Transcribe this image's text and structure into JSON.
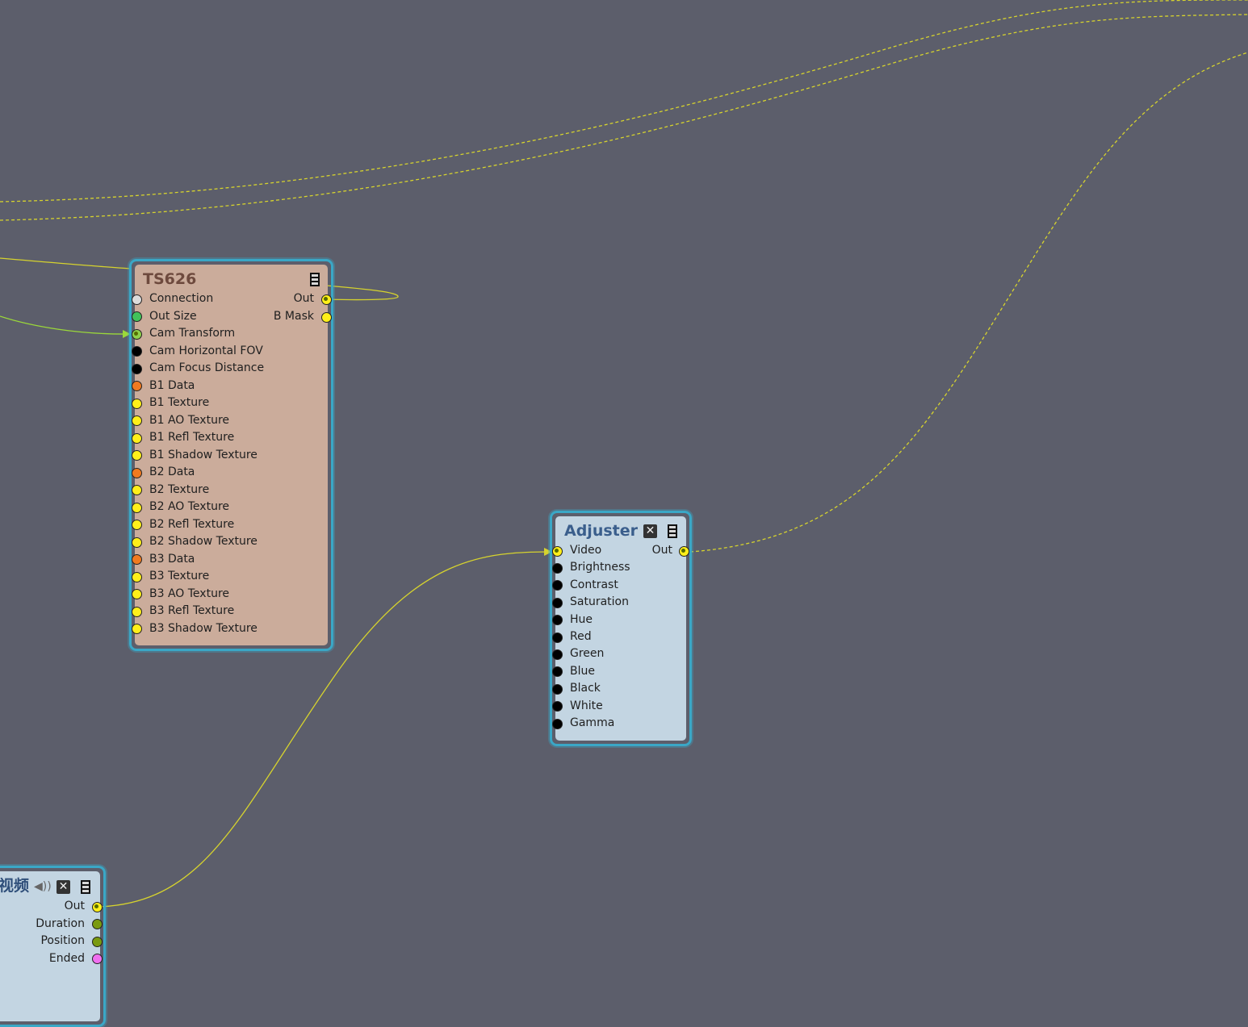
{
  "canvas": {
    "background": "#5c5e6b",
    "wire_color": "#d6d32e",
    "transform_wire_color": "#9bd83a"
  },
  "nodes": {
    "ts626": {
      "title": "TS626",
      "menu_icon": "menu-icon",
      "inputs": [
        {
          "label": "Connection",
          "color": "#dcdcdc"
        },
        {
          "label": "Out Size",
          "color": "#42c25a"
        },
        {
          "label": "Cam Transform",
          "color": "#8fd04a"
        },
        {
          "label": "Cam Horizontal FOV",
          "color": "#000000"
        },
        {
          "label": "Cam Focus Distance",
          "color": "#000000"
        },
        {
          "label": "B1 Data",
          "color": "#f07a20"
        },
        {
          "label": "B1 Texture",
          "color": "#ffef1a"
        },
        {
          "label": "B1 AO Texture",
          "color": "#ffef1a"
        },
        {
          "label": "B1 Refl Texture",
          "color": "#ffef1a"
        },
        {
          "label": "B1 Shadow Texture",
          "color": "#ffef1a"
        },
        {
          "label": "B2 Data",
          "color": "#f07a20"
        },
        {
          "label": "B2 Texture",
          "color": "#ffef1a"
        },
        {
          "label": "B2 AO Texture",
          "color": "#ffef1a"
        },
        {
          "label": "B2 Refl Texture",
          "color": "#ffef1a"
        },
        {
          "label": "B2 Shadow Texture",
          "color": "#ffef1a"
        },
        {
          "label": "B3 Data",
          "color": "#f07a20"
        },
        {
          "label": "B3 Texture",
          "color": "#ffef1a"
        },
        {
          "label": "B3 AO Texture",
          "color": "#ffef1a"
        },
        {
          "label": "B3 Refl Texture",
          "color": "#ffef1a"
        },
        {
          "label": "B3 Shadow Texture",
          "color": "#ffef1a"
        }
      ],
      "outputs": [
        {
          "label": "Out",
          "color": "#ffef1a"
        },
        {
          "label": "B Mask",
          "color": "#ffef1a"
        }
      ]
    },
    "adjuster": {
      "title": "Adjuster",
      "close_icon": "close-icon",
      "menu_icon": "menu-icon",
      "inputs": [
        {
          "label": "Video",
          "color": "#ffef1a"
        },
        {
          "label": "Brightness",
          "color": "#000000"
        },
        {
          "label": "Contrast",
          "color": "#000000"
        },
        {
          "label": "Saturation",
          "color": "#000000"
        },
        {
          "label": "Hue",
          "color": "#000000"
        },
        {
          "label": "Red",
          "color": "#000000"
        },
        {
          "label": "Green",
          "color": "#000000"
        },
        {
          "label": "Blue",
          "color": "#000000"
        },
        {
          "label": "Black",
          "color": "#000000"
        },
        {
          "label": "White",
          "color": "#000000"
        },
        {
          "label": "Gamma",
          "color": "#000000"
        }
      ],
      "outputs": [
        {
          "label": "Out",
          "color": "#ffef1a"
        }
      ]
    },
    "video": {
      "title": "视频",
      "speaker_icon": "speaker-icon",
      "close_icon": "close-icon",
      "menu_icon": "menu-icon",
      "outputs": [
        {
          "label": "Out",
          "color": "#ffef1a"
        },
        {
          "label": "Duration",
          "color": "#7a9a10"
        },
        {
          "label": "Position",
          "color": "#7a9a10"
        },
        {
          "label": "Ended",
          "color": "#f070f0"
        }
      ]
    }
  }
}
